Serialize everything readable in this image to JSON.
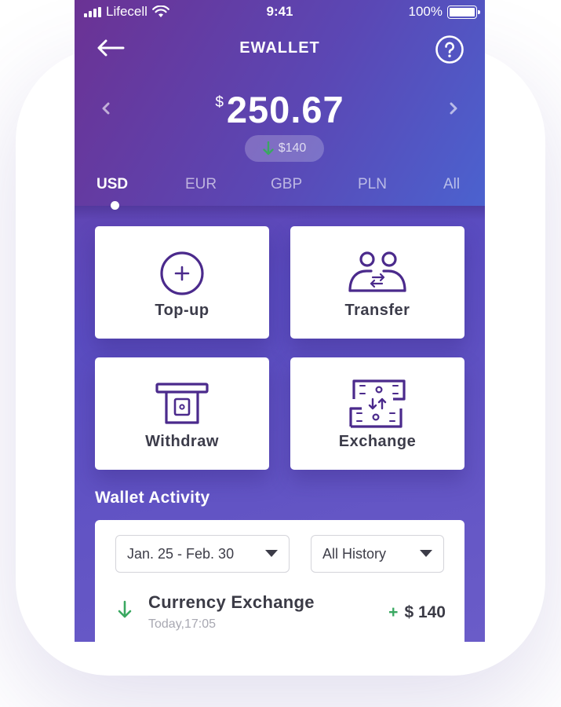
{
  "status_bar": {
    "carrier": "Lifecell",
    "time": "9:41",
    "battery": "100%"
  },
  "nav": {
    "title": "EWALLET",
    "back_icon": "arrow-left-icon",
    "help_icon": "question-circle-icon"
  },
  "balance": {
    "currency_symbol": "$",
    "amount": "250.67",
    "change": "$140",
    "change_direction": "down"
  },
  "currency_tabs": [
    {
      "label": "USD",
      "active": true
    },
    {
      "label": "EUR",
      "active": false
    },
    {
      "label": "GBP",
      "active": false
    },
    {
      "label": "PLN",
      "active": false
    },
    {
      "label": "All",
      "active": false
    }
  ],
  "actions": [
    {
      "label": "Top-up",
      "icon": "plus-circle-icon"
    },
    {
      "label": "Transfer",
      "icon": "users-transfer-icon"
    },
    {
      "label": "Withdraw",
      "icon": "atm-icon"
    },
    {
      "label": "Exchange",
      "icon": "exchange-icon"
    }
  ],
  "activity": {
    "title": "Wallet Activity",
    "date_filter": "Jan. 25 - Feb. 30",
    "history_filter": "All History",
    "transactions": [
      {
        "title": "Currency Exchange",
        "time": "Today,17:05",
        "sign": "+",
        "amount": "$ 140"
      }
    ]
  },
  "colors": {
    "accent": "#4b2a8c",
    "positive": "#3aa861",
    "header_start": "#6b3294",
    "header_end": "#4b62cf"
  }
}
